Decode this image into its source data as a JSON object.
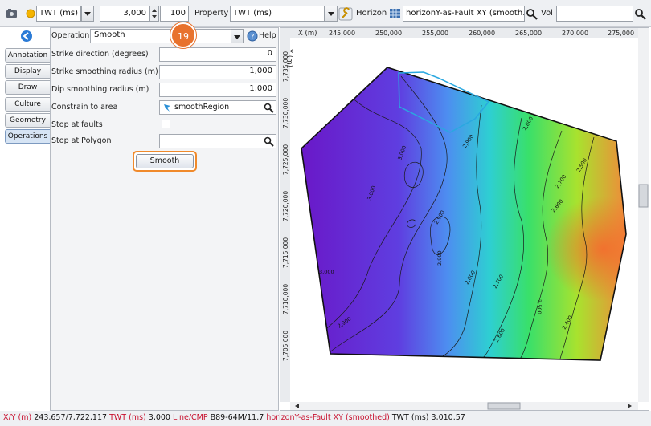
{
  "toolbar": {
    "domain_value": "TWT (ms)",
    "z_value": "3,000",
    "step_value": "100",
    "property_label": "Property",
    "property_value": "TWT (ms)",
    "horizon_label": "Horizon",
    "horizon_value": "horizonY-as-Fault XY (smooth...",
    "vol_label": "Vol",
    "vol_value": ""
  },
  "tabs": [
    {
      "label": "Annotation"
    },
    {
      "label": "Display"
    },
    {
      "label": "Draw"
    },
    {
      "label": "Culture"
    },
    {
      "label": "Geometry"
    },
    {
      "label": "Operations"
    }
  ],
  "panel": {
    "operation_label": "Operation",
    "operation_value": "Smooth",
    "help_label": "Help",
    "fields": [
      {
        "label": "Strike direction (degrees)",
        "value": "0"
      },
      {
        "label": "Strike smoothing radius (m)",
        "value": "1,000"
      },
      {
        "label": "Dip smoothing radius (m)",
        "value": "1,000"
      }
    ],
    "constrain_label": "Constrain to area",
    "constrain_value": "smoothRegion",
    "stop_faults_label": "Stop at faults",
    "stop_polygon_label": "Stop at Polygon",
    "stop_polygon_value": "",
    "smooth_button": "Smooth",
    "callout_number": "19"
  },
  "map": {
    "x_axis_title": "X (m)",
    "y_axis_title": "Y (m)",
    "x_ticks": [
      "245,000",
      "250,000",
      "255,000",
      "260,000",
      "265,000",
      "270,000",
      "275,000"
    ],
    "y_ticks": [
      "7,735,000",
      "7,730,000",
      "7,725,000",
      "7,720,000",
      "7,715,000",
      "7,710,000",
      "7,705,000"
    ],
    "contour_labels": [
      "2,800",
      "2,900",
      "3,000",
      "2,700",
      "2,600",
      "2,500",
      "2,900",
      "3,000",
      "2,900",
      "2,800",
      "2,700",
      "2,500",
      "2,400",
      "2,600",
      "3,000",
      "2,900"
    ]
  },
  "status": {
    "xy_label": "X/Y (m)",
    "xy_value": "243,657/7,722,117",
    "twt_label": "TWT (ms)",
    "twt_value": "3,000",
    "line_label": "Line/CMP",
    "line_value": "B89-64M/11.7",
    "horizon_name": "horizonY-as-Fault XY (smoothed)",
    "horizon_twt": "TWT (ms) 3,010.57"
  },
  "colors": {
    "accent": "#e8722d",
    "status_red": "#c8102e",
    "polygon_cyan": "#2aa8e0"
  }
}
